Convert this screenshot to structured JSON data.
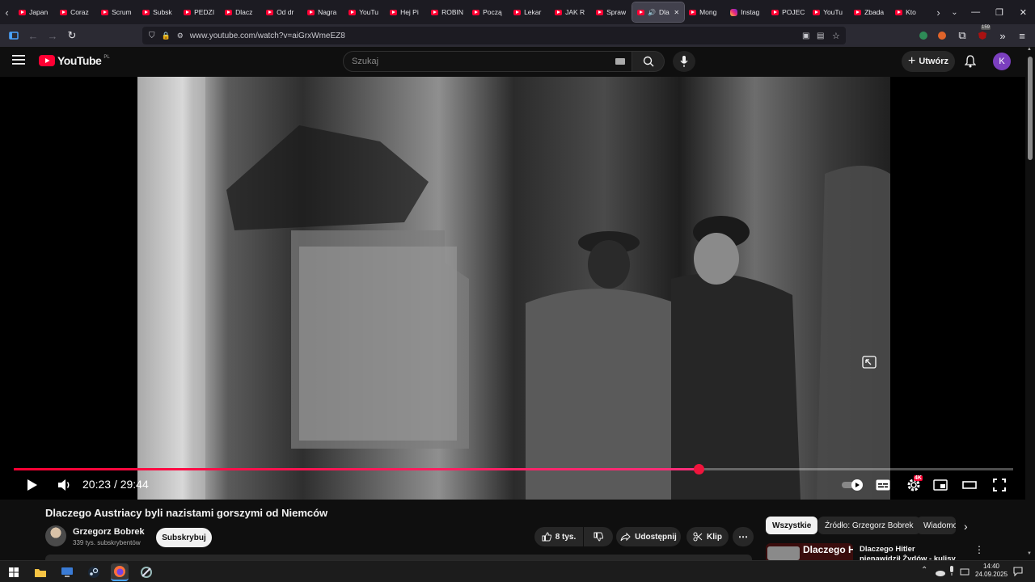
{
  "browser": {
    "tabs": [
      {
        "label": "Japan",
        "icon": "youtube"
      },
      {
        "label": "Coraz",
        "icon": "youtube"
      },
      {
        "label": "Scrum",
        "icon": "youtube"
      },
      {
        "label": "Subsk",
        "icon": "youtube"
      },
      {
        "label": "PEDZI",
        "icon": "youtube"
      },
      {
        "label": "Dlacz",
        "icon": "youtube"
      },
      {
        "label": "Od dr",
        "icon": "youtube"
      },
      {
        "label": "Nagra",
        "icon": "youtube"
      },
      {
        "label": "YouTu",
        "icon": "youtube"
      },
      {
        "label": "Hej Pi",
        "icon": "youtube"
      },
      {
        "label": "ROBIN",
        "icon": "youtube"
      },
      {
        "label": "Począ",
        "icon": "youtube"
      },
      {
        "label": "Lekar",
        "icon": "youtube"
      },
      {
        "label": "JAK R",
        "icon": "youtube"
      },
      {
        "label": "Spraw",
        "icon": "youtube"
      },
      {
        "label": "Dla",
        "icon": "youtube",
        "active": true
      },
      {
        "label": "Mong",
        "icon": "youtube"
      },
      {
        "label": "Instag",
        "icon": "instagram"
      },
      {
        "label": "POJEC",
        "icon": "youtube"
      },
      {
        "label": "YouTu",
        "icon": "youtube"
      },
      {
        "label": "Zbada",
        "icon": "youtube"
      },
      {
        "label": "Kto",
        "icon": "youtube"
      }
    ],
    "url": "www.youtube.com/watch?v=aiGrxWmeEZ8",
    "extension_badge": "159"
  },
  "youtube": {
    "logo_text": "YouTube",
    "region": "PL",
    "search_placeholder": "Szukaj",
    "create_label": "Utwórz",
    "avatar_letter": "K"
  },
  "player": {
    "time_current": "20:23",
    "time_separator": "/",
    "time_total": "29:44",
    "progress_fraction": 0.685,
    "quality_badge": "4K",
    "accent": "#ff0033"
  },
  "video": {
    "title": "Dlaczego Austriacy byli nazistami gorszymi od Niemców",
    "channel_name": "Grzegorz Bobrek",
    "subscribers": "339 tys. subskrybentów",
    "subscribe_label": "Subskrybuj",
    "likes": "8 tys.",
    "share_label": "Udostępnij",
    "clip_label": "Klip"
  },
  "sidebar": {
    "chips": [
      "Wszystkie",
      "Źródło: Grzegorz Bobrek",
      "Wiadomo"
    ],
    "recommended": {
      "thumb_text": "Dlaczego Hitler",
      "title": "Dlaczego Hitler nienawidził Żydów - kulisy obsesji"
    }
  },
  "taskbar": {
    "time": "14:40",
    "date": "24.09.2025"
  }
}
